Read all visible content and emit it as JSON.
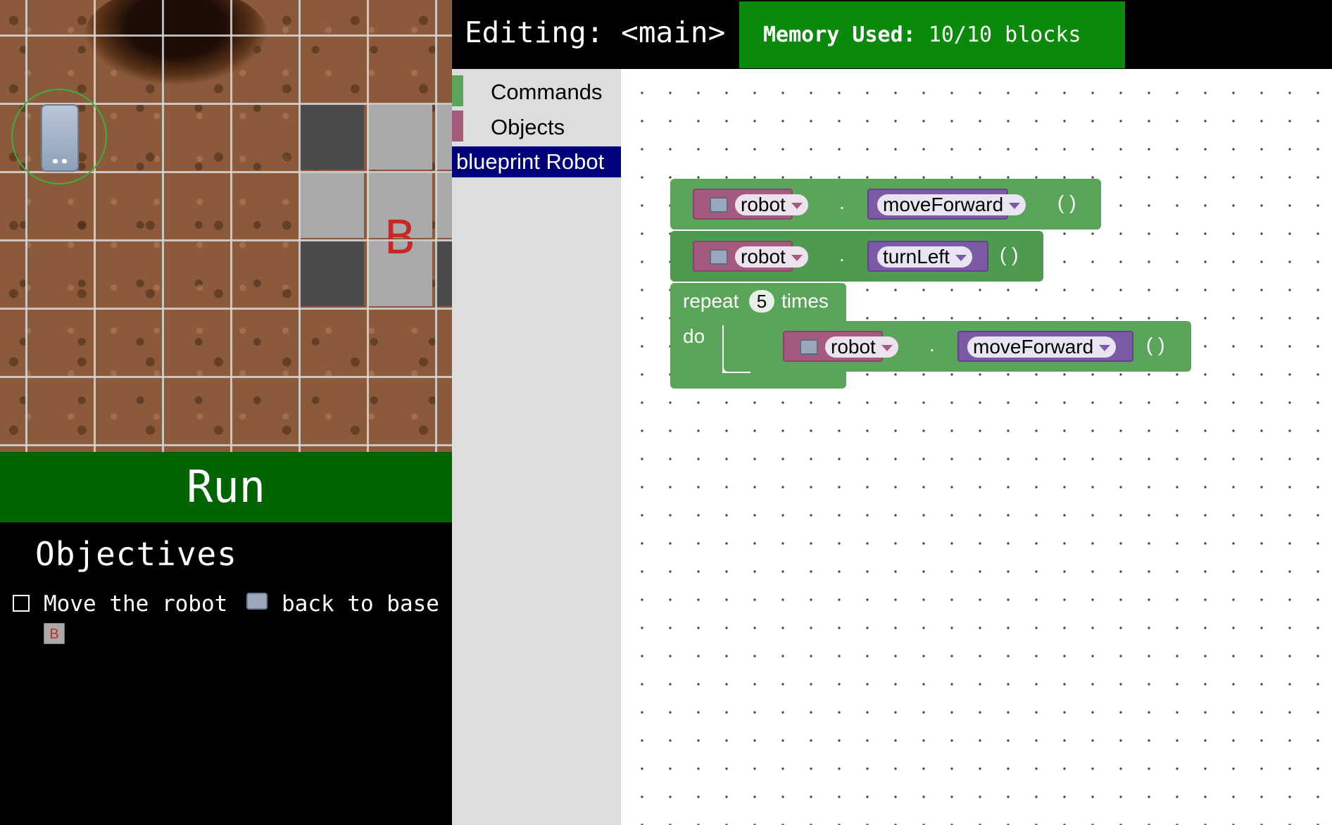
{
  "header": {
    "editing": "Editing: <main>",
    "memory_label": "Memory Used:",
    "memory_value": "10/10 blocks"
  },
  "game": {
    "base_letter": "B"
  },
  "run_label": "Run",
  "objectives": {
    "title": "Objectives",
    "items": [
      {
        "text_before": "Move the robot",
        "text_after": "back to base",
        "base_icon": "B",
        "checked": false
      }
    ]
  },
  "toolbox": {
    "categories": [
      {
        "label": "Commands",
        "color": "#5ba55b"
      },
      {
        "label": "Objects",
        "color": "#a55b80"
      }
    ],
    "selected": "blueprint Robot"
  },
  "workspace": {
    "blocks": [
      {
        "object": "robot",
        "method": "moveForward",
        "dot": ".",
        "parens": "( )"
      },
      {
        "object": "robot",
        "method": "turnLeft",
        "dot": ".",
        "parens": "( )"
      }
    ],
    "repeat": {
      "label": "repeat",
      "count": "5",
      "times": "times",
      "do": "do",
      "body": {
        "object": "robot",
        "method": "moveForward",
        "dot": ".",
        "parens": "( )"
      }
    }
  },
  "colors": {
    "run": "#006400",
    "memory": "#0a8a0a",
    "block_green": "#5ba55b",
    "object_pink": "#a55b80",
    "method_purple": "#7c5ba6",
    "blueprint_bg": "#00007b"
  }
}
